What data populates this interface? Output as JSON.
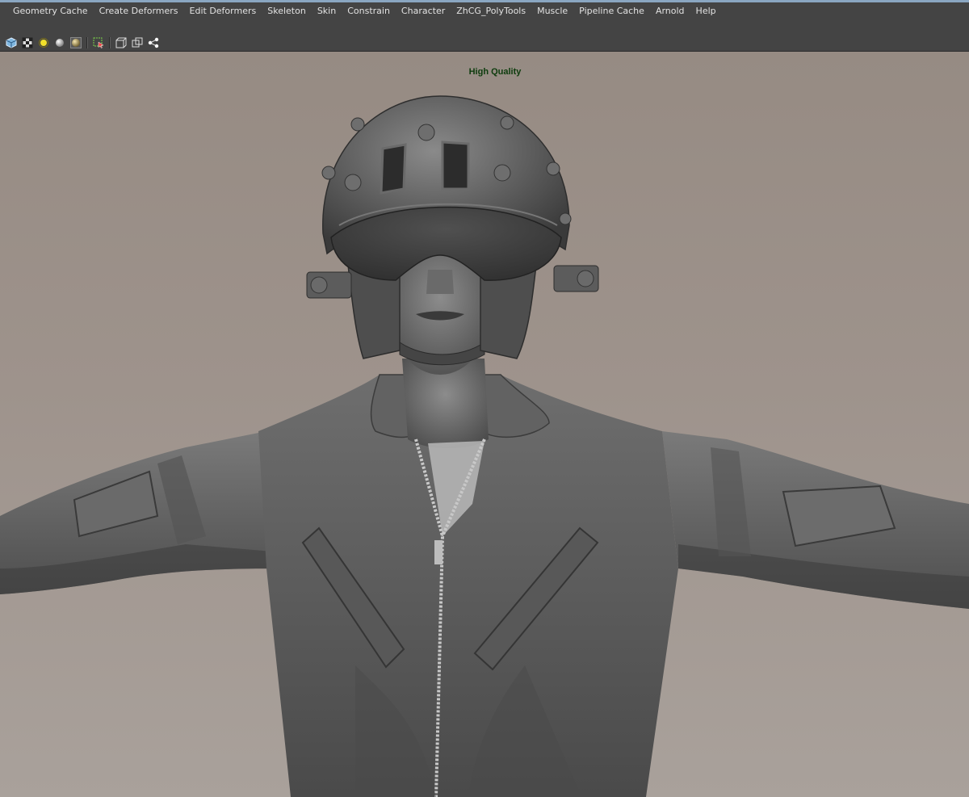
{
  "menu": {
    "items": [
      {
        "label": "Geometry Cache"
      },
      {
        "label": "Create Deformers"
      },
      {
        "label": "Edit Deformers"
      },
      {
        "label": "Skeleton"
      },
      {
        "label": "Skin"
      },
      {
        "label": "Constrain"
      },
      {
        "label": "Character"
      },
      {
        "label": "ZhCG_PolyTools"
      },
      {
        "label": "Muscle"
      },
      {
        "label": "Pipeline Cache"
      },
      {
        "label": "Arnold"
      },
      {
        "label": "Help"
      }
    ]
  },
  "toolbar": {
    "icons": [
      "shaded-cube-icon",
      "textured-checker-icon",
      "default-light-icon",
      "sphere-light-icon",
      "material-ball-icon",
      "isolate-select-icon",
      "wireframe-cube-icon",
      "xray-icon",
      "node-graph-icon"
    ]
  },
  "viewport": {
    "renderer_label": "High Quality",
    "label_color": "#0d3c0d",
    "background_color": "#9b9089",
    "model_color": "#5e5e5e"
  }
}
